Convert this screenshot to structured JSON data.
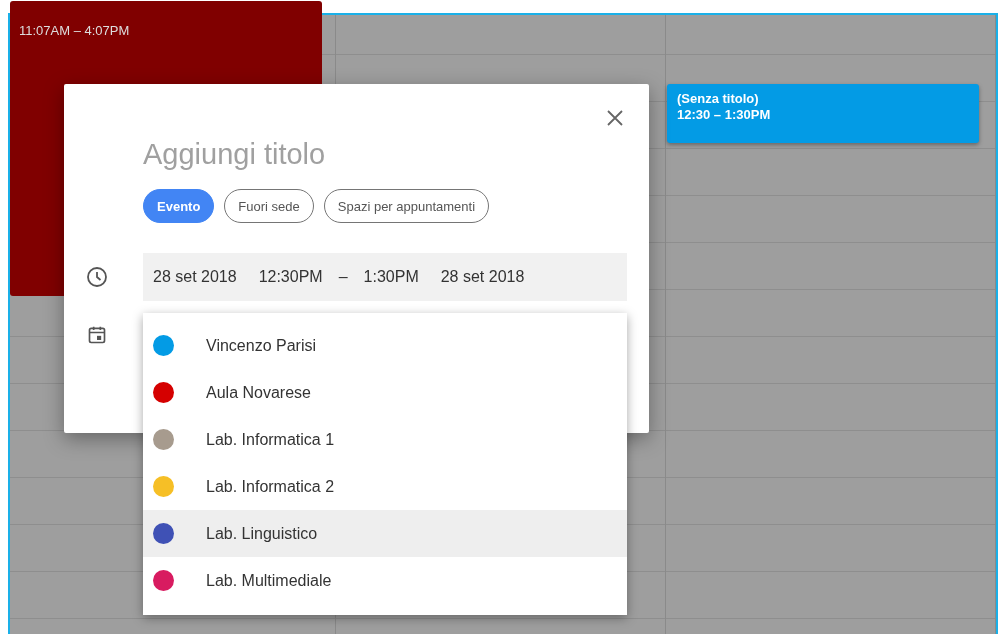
{
  "events": [
    {
      "kind": "busy",
      "time": "11:07AM – 4:07PM",
      "color": "#800000"
    },
    {
      "kind": "new",
      "title": "(Senza titolo)",
      "time": "12:30 – 1:30PM",
      "color": "#039be5"
    }
  ],
  "dialog": {
    "title_placeholder": "Aggiungi titolo",
    "chips": [
      {
        "label": "Evento",
        "selected": true
      },
      {
        "label": "Fuori sede",
        "selected": false
      },
      {
        "label": "Spazi per appuntamenti",
        "selected": false
      }
    ],
    "datetime": {
      "start_date": "28 set 2018",
      "start_time": "12:30PM",
      "separator": "–",
      "end_time": "1:30PM",
      "end_date": "28 set 2018"
    },
    "calendars": [
      {
        "name": "Vincenzo Parisi",
        "color": "#039be5",
        "selected": false
      },
      {
        "name": "Aula Novarese",
        "color": "#d50000",
        "selected": false
      },
      {
        "name": "Lab. Informatica 1",
        "color": "#a79b8e",
        "selected": false
      },
      {
        "name": "Lab. Informatica 2",
        "color": "#f6bf26",
        "selected": false
      },
      {
        "name": "Lab. Linguistico",
        "color": "#3f51b5",
        "selected": true
      },
      {
        "name": "Lab. Multimediale",
        "color": "#d81b60",
        "selected": false
      }
    ]
  }
}
